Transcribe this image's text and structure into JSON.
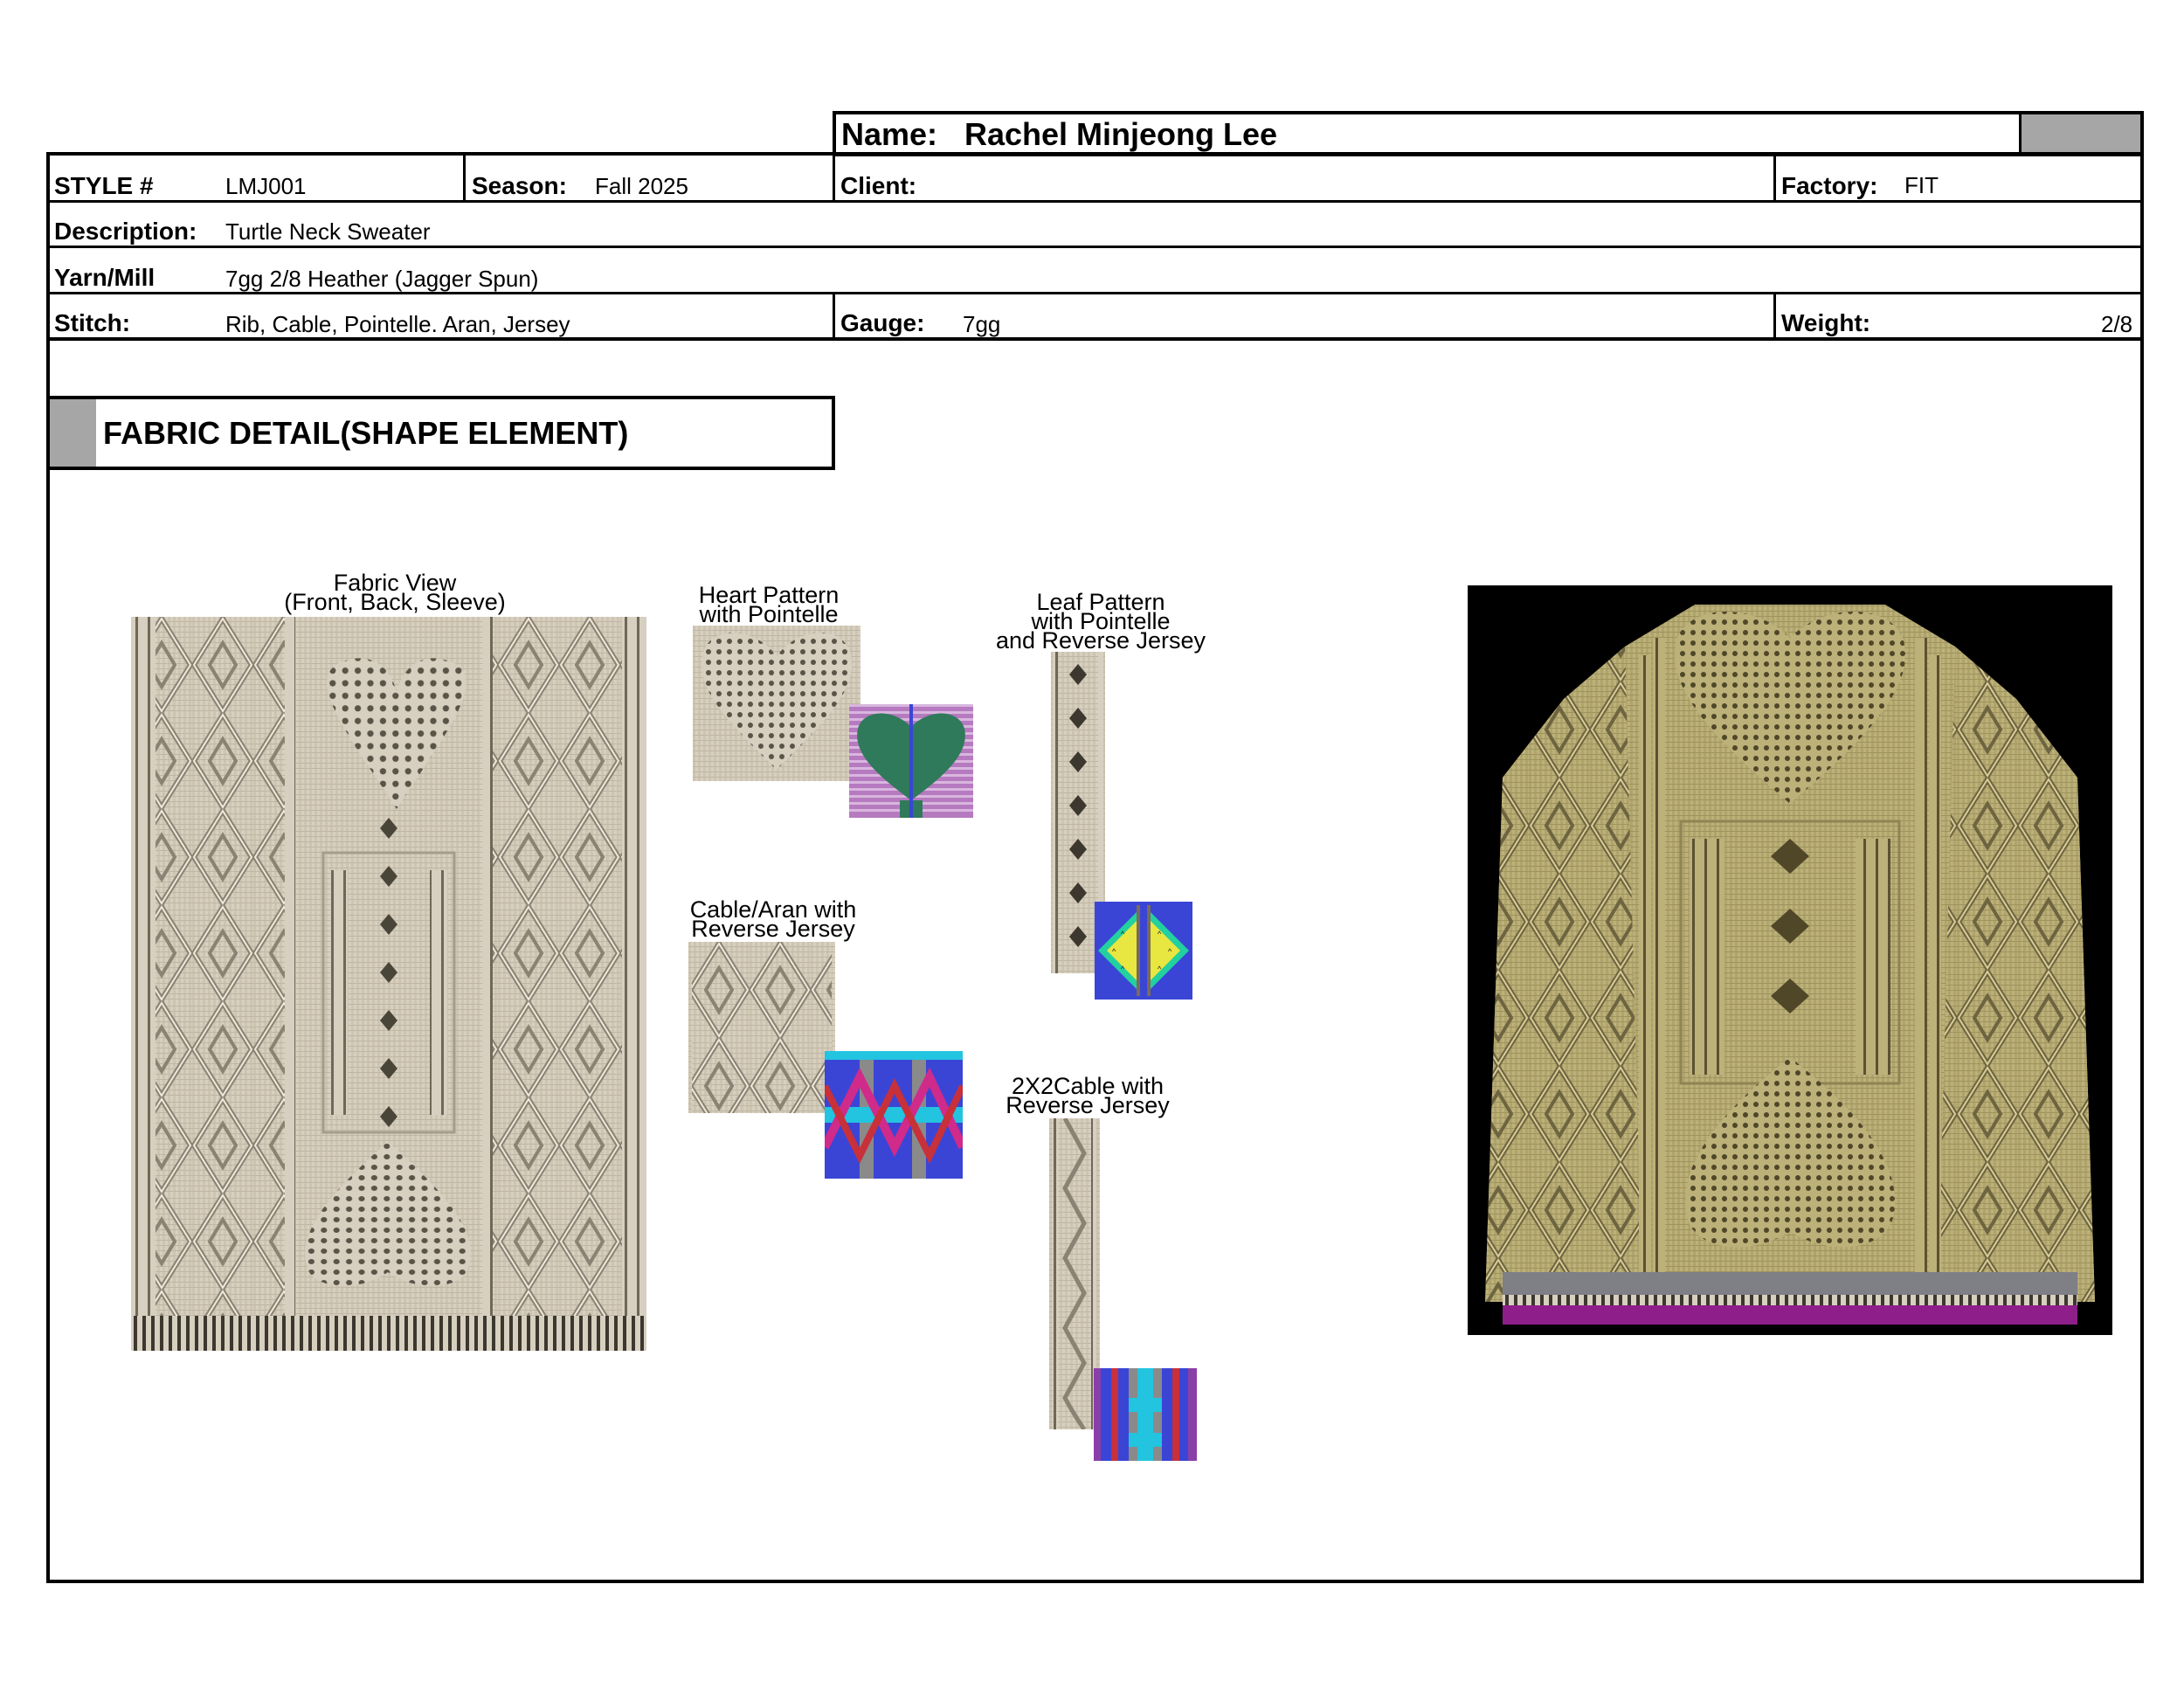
{
  "header": {
    "name_label": "Name:",
    "name_value": "Rachel Minjeong Lee",
    "style_label": "STYLE #",
    "style_value": "LMJ001",
    "season_label": "Season:",
    "season_value": "Fall 2025",
    "client_label": "Client:",
    "client_value": "",
    "factory_label": "Factory:",
    "factory_value": "FIT",
    "description_label": "Description:",
    "description_value": "Turtle Neck Sweater",
    "yarn_label": "Yarn/Mill",
    "yarn_value": "7gg  2/8 Heather (Jagger Spun)",
    "stitch_label": "Stitch:",
    "stitch_value": "Rib, Cable, Pointelle. Aran, Jersey",
    "gauge_label": "Gauge:",
    "gauge_value": "7gg",
    "weight_label": "Weight:",
    "weight_value": "2/8"
  },
  "section": {
    "title": "FABRIC DETAIL(SHAPE ELEMENT)"
  },
  "captions": {
    "fabric_view_1": "Fabric View",
    "fabric_view_2": "(Front, Back, Sleeve)",
    "heart_1": "Heart Pattern",
    "heart_2": "with Pointelle",
    "leaf_1": "Leaf Pattern",
    "leaf_2": "with Pointelle",
    "leaf_3": "and Reverse Jersey",
    "cable_1": "Cable/Aran with",
    "cable_2": "Reverse Jersey",
    "twoxtwo_1": "2X2Cable with",
    "twoxtwo_2": "Reverse Jersey"
  },
  "colors": {
    "fabric": "#d7cfbf",
    "fabric_dark": "#7a7366",
    "sweater": "#bdb17a",
    "sweater_dark": "#6d6440",
    "header_gray": "#a6a6a6",
    "chart_blue": "#3a45d6",
    "chart_green": "#2f7a5a",
    "chart_cyan": "#22c4e0",
    "chart_purple": "#8a3fa8"
  }
}
